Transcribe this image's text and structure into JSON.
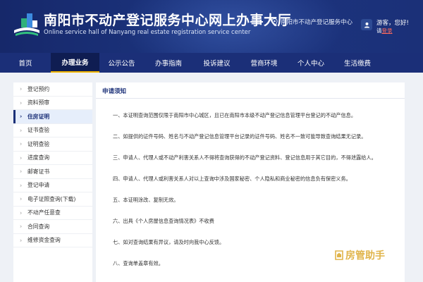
{
  "header": {
    "title_cn": "南阳市不动产登记服务中心网上办事大厅",
    "title_en": "Online service hall of Nanyang real estate registration service center",
    "location": "南阳市不动产登记服务中心",
    "greeting": "游客，您好!",
    "login_prompt": "请",
    "login_link": "登录"
  },
  "nav": {
    "items": [
      {
        "label": "首页"
      },
      {
        "label": "办理业务"
      },
      {
        "label": "公示公告"
      },
      {
        "label": "办事指南"
      },
      {
        "label": "投诉建议"
      },
      {
        "label": "营商环境"
      },
      {
        "label": "个人中心"
      },
      {
        "label": "生活缴费"
      }
    ],
    "active": "办理业务"
  },
  "sidebar": {
    "items": [
      {
        "label": "登记预约"
      },
      {
        "label": "资料预审"
      },
      {
        "label": "住房证明"
      },
      {
        "label": "证书查验"
      },
      {
        "label": "证明查验"
      },
      {
        "label": "进度查询"
      },
      {
        "label": "邮寄证书"
      },
      {
        "label": "登记申请"
      },
      {
        "label": "电子证照查询(下载)"
      },
      {
        "label": "不动产任意查"
      },
      {
        "label": "合同查询"
      },
      {
        "label": "维修资金查询"
      }
    ],
    "active": "住房证明"
  },
  "content": {
    "title": "申请须知",
    "notices": [
      "一、本证明查询范围仅限于南阳市中心城区，且已在南阳市本级不动产登记信息管理平台登记的不动产信息。",
      "二、如提供的证件号码、姓名与不动产登记信息管理平台记录的证件号码、姓名不一致可能导致查询结果无记录。",
      "三、申请人、代理人或不动产利害关系人不得将查询获得的不动产登记资料、登记信息用于其它目的，不得泄露给人。",
      "四、申请人、代理人或利害关系人对以上查询中涉及国家秘密、个人隐私和商业秘密的信息负有保密义务。",
      "五、本证明涂改、复制无效。",
      "六、出具《个人房屋信息查询情况表》不收费",
      "七、如对查询结果有异议，请及时向我中心反馈。",
      "八、查询单盖章有效。"
    ]
  },
  "watermark": "房管助手",
  "colors": {
    "header_bg": "#1b3078",
    "nav_active_bg": "#0f1d52",
    "nav_active_underline": "#f0b400",
    "login_link": "#ff6a5c",
    "sidebar_active_bg": "#e6eefb",
    "watermark": "#d9a21e"
  }
}
